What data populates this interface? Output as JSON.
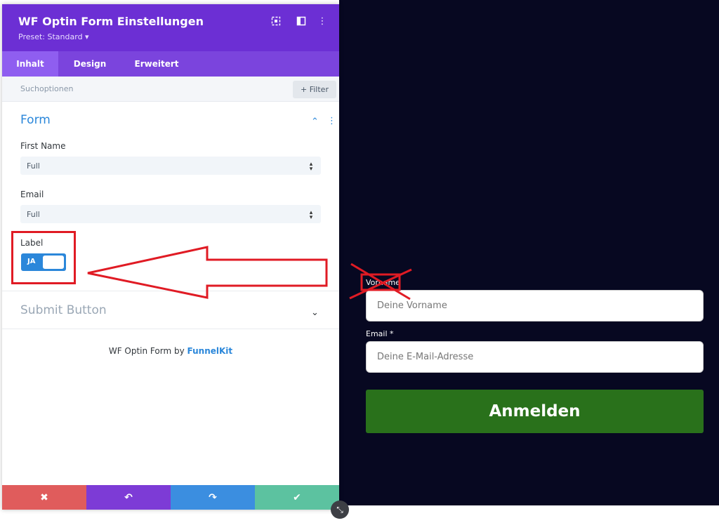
{
  "panel": {
    "title": "WF Optin Form Einstellungen",
    "preset": "Preset: Standard ▾",
    "header_icons": [
      "target-icon",
      "columns-icon",
      "more-vertical-icon"
    ]
  },
  "tabs": [
    {
      "label": "Inhalt",
      "active": true
    },
    {
      "label": "Design",
      "active": false
    },
    {
      "label": "Erweitert",
      "active": false
    }
  ],
  "search": {
    "placeholder": "Suchoptionen",
    "filter_label": "+ Filter"
  },
  "form_section": {
    "title": "Form",
    "first_name": {
      "label": "First Name",
      "value": "Full"
    },
    "email": {
      "label": "Email",
      "value": "Full"
    },
    "label_toggle": {
      "label": "Label",
      "state": "JA"
    }
  },
  "submit_section": {
    "title": "Submit Button"
  },
  "credit": {
    "prefix": "WF Optin Form by ",
    "brand": "FunnelKit"
  },
  "footer": {
    "buttons": [
      {
        "name": "close",
        "glyph": "✖",
        "color": "#e05c5c"
      },
      {
        "name": "undo",
        "glyph": "↶",
        "color": "#7d3bd6"
      },
      {
        "name": "redo",
        "glyph": "↷",
        "color": "#3b8ee0"
      },
      {
        "name": "save",
        "glyph": "✔",
        "color": "#5cc2a0"
      }
    ]
  },
  "preview": {
    "vorname_label": "Vorname",
    "vorname_placeholder": "Deine Vorname",
    "email_label": "Email *",
    "email_placeholder": "Deine E-Mail-Adresse",
    "submit_label": "Anmelden"
  },
  "colors": {
    "header": "#6c2fd4",
    "accent": "#2b87da",
    "preview_bg": "#070821",
    "submit_green": "#29711b",
    "annotation_red": "#e01b24"
  }
}
